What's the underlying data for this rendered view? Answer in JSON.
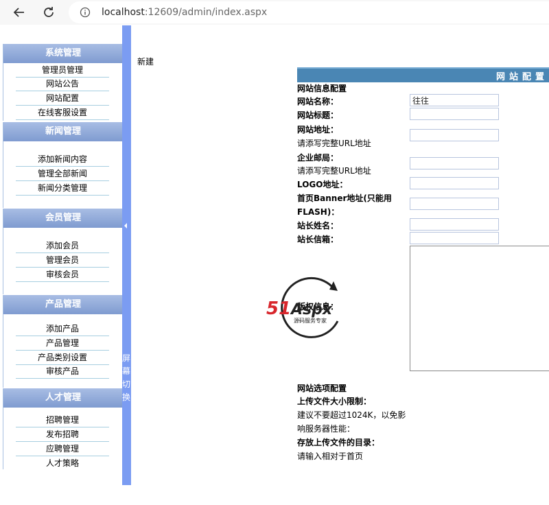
{
  "browser": {
    "url_host": "localhost",
    "url_path": ":12609/admin/index.aspx"
  },
  "sidebar": {
    "sections": [
      {
        "title": "系统管理",
        "items": [
          "管理员管理",
          "网站公告",
          "网站配置",
          "在线客服设置"
        ]
      },
      {
        "title": "新闻管理",
        "items": [
          "添加新闻内容",
          "管理全部新闻",
          "新闻分类管理"
        ]
      },
      {
        "title": "会员管理",
        "items": [
          "添加会员",
          "管理会员",
          "审核会员"
        ]
      },
      {
        "title": "产品管理",
        "items": [
          "添加产品",
          "产品管理",
          "产品类别设置",
          "审核产品"
        ]
      },
      {
        "title": "人才管理",
        "items": [
          "招聘管理",
          "发布招聘",
          "应聘管理",
          "人才策略"
        ]
      }
    ],
    "toggle_text": "屏幕切换"
  },
  "main": {
    "new_label": "新建",
    "header_title": "网站配置",
    "site_info_title": "网站信息配置",
    "site_name_label": "网站名称：",
    "site_name_value": "往往",
    "site_title_label": "网站标题：",
    "site_url_label": "网站地址：",
    "site_url_hint": "请添写完整URL地址",
    "email_label": "企业邮局：",
    "email_hint": "请添写完整URL地址",
    "logo_label": "LOGO地址：",
    "banner_label_1": "首页Banner地址(只能用",
    "banner_label_2": "FLASH)：",
    "owner_name_label": "站长姓名：",
    "owner_email_label": "站长信箱：",
    "copyright_label": "版权信息：",
    "options_title": "网站选项配置",
    "upload_limit_label": "上传文件大小限制：",
    "upload_limit_hint_1": "建议不要超过1024K，以免影",
    "upload_limit_hint_2": "响服务器性能：",
    "upload_dir_label": "存放上传文件的目录：",
    "upload_dir_hint": "请输入相对于首页"
  },
  "watermark": {
    "brand": "51Aspx",
    "tagline": "源码服务专家"
  },
  "colors": {
    "section_header": "#8ea8d9",
    "splitter": "#7b9cf2",
    "header_bar": "#4a86b4"
  }
}
